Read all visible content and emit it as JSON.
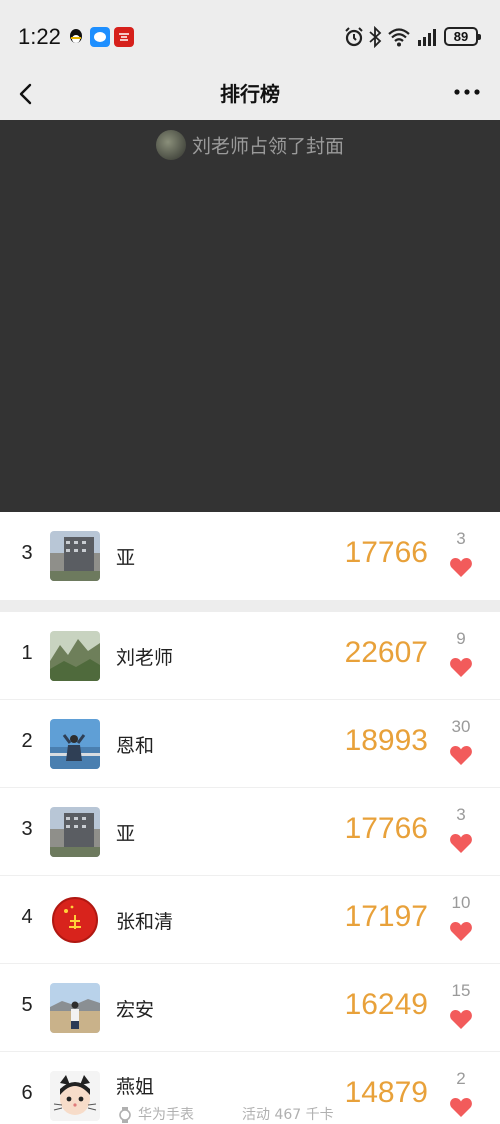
{
  "status_bar": {
    "time": "1:22",
    "battery": "89",
    "icons": [
      "qq-icon",
      "message-icon",
      "app-icon",
      "alarm-icon",
      "bluetooth-icon",
      "wifi-icon",
      "signal-icon"
    ]
  },
  "nav": {
    "title": "排行榜",
    "back_icon": "chevron-left-icon",
    "more_icon": "more-icon"
  },
  "cover": {
    "text": "刘老师占领了封面"
  },
  "my_rank": {
    "rank": "3",
    "name": "亚",
    "steps": "17766",
    "likes": "3"
  },
  "ranking": [
    {
      "rank": "1",
      "name": "刘老师",
      "steps": "22607",
      "likes": "9"
    },
    {
      "rank": "2",
      "name": "恩和",
      "steps": "18993",
      "likes": "30"
    },
    {
      "rank": "3",
      "name": "亚",
      "steps": "17766",
      "likes": "3"
    },
    {
      "rank": "4",
      "name": "张和清",
      "steps": "17197",
      "likes": "10"
    },
    {
      "rank": "5",
      "name": "宏安",
      "steps": "16249",
      "likes": "15"
    },
    {
      "rank": "6",
      "name": "燕姐",
      "steps": "14879",
      "likes": "2"
    }
  ],
  "last_row_meta": {
    "device": "华为手表",
    "activity": "活动 467 千卡"
  },
  "colors": {
    "steps": "#e8a13a",
    "heart": "#f25b5b",
    "cover_bg": "#333333",
    "bar_bg": "#ededed"
  }
}
